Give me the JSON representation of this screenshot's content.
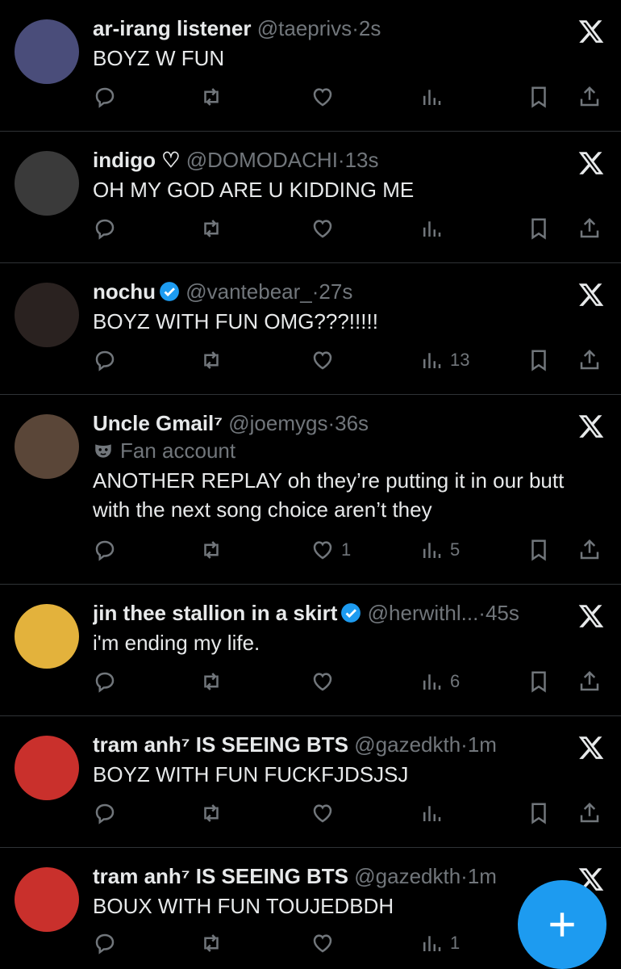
{
  "colors": {
    "background": "#000000",
    "text": "#e7e9ea",
    "muted": "#71767b",
    "divider": "#2f3336",
    "accent": "#1d9bf0"
  },
  "tweets": [
    {
      "name": "ar-irang listener",
      "handle": "@taeprivs",
      "sep": "·",
      "time": "2s",
      "text": "BOYZ W FUN",
      "likes": "",
      "views": "",
      "avatar_color": "#4a4d7a",
      "verified": false
    },
    {
      "name": "indigo ♡",
      "handle": "@DOMODACHI",
      "sep": "·",
      "time": "13s",
      "text": "OH MY GOD ARE U KIDDING ME",
      "likes": "",
      "views": "",
      "avatar_color": "#3a3a3a",
      "verified": false
    },
    {
      "name": "nochu",
      "handle": "@vantebear_",
      "sep": "·",
      "time": "27s",
      "text": "BOYZ WITH FUN OMG???!!!!!",
      "likes": "",
      "views": "13",
      "avatar_color": "#2a2220",
      "verified": true
    },
    {
      "name": "Uncle Gmail⁷",
      "handle": "@joemygs",
      "sep": "·",
      "time": "36s",
      "label": "Fan account",
      "text": "ANOTHER REPLAY oh they’re putting it in our butt with the next song choice aren’t they",
      "likes": "1",
      "views": "5",
      "avatar_color": "#5a4638",
      "verified": false
    },
    {
      "name": "jin thee stallion in a skirt",
      "handle": "@herwithl...",
      "sep": "·",
      "time": "45s",
      "text": "i'm ending my life.",
      "likes": "",
      "views": "6",
      "avatar_color": "#e3b23c",
      "verified": true
    },
    {
      "name": "tram anh⁷ IS SEEING BTS",
      "handle": "@gazedkth",
      "sep": "·",
      "time": "1m",
      "text": "BOYZ WITH FUN FUCKFJDSJSJ",
      "likes": "",
      "views": "",
      "avatar_color": "#c9302c",
      "verified": false
    },
    {
      "name": "tram anh⁷ IS SEEING BTS",
      "handle": "@gazedkth",
      "sep": "·",
      "time": "1m",
      "text": "BOUX WITH FUN TOUJEDBDH",
      "likes": "",
      "views": "1",
      "avatar_color": "#c9302c",
      "verified": false
    }
  ],
  "icons": {
    "reply": "reply-icon",
    "retweet": "retweet-icon",
    "like": "heart-icon",
    "views": "views-icon",
    "bookmark": "bookmark-icon",
    "share": "share-icon",
    "delete": "x-logo-icon",
    "compose": "plus-icon"
  }
}
